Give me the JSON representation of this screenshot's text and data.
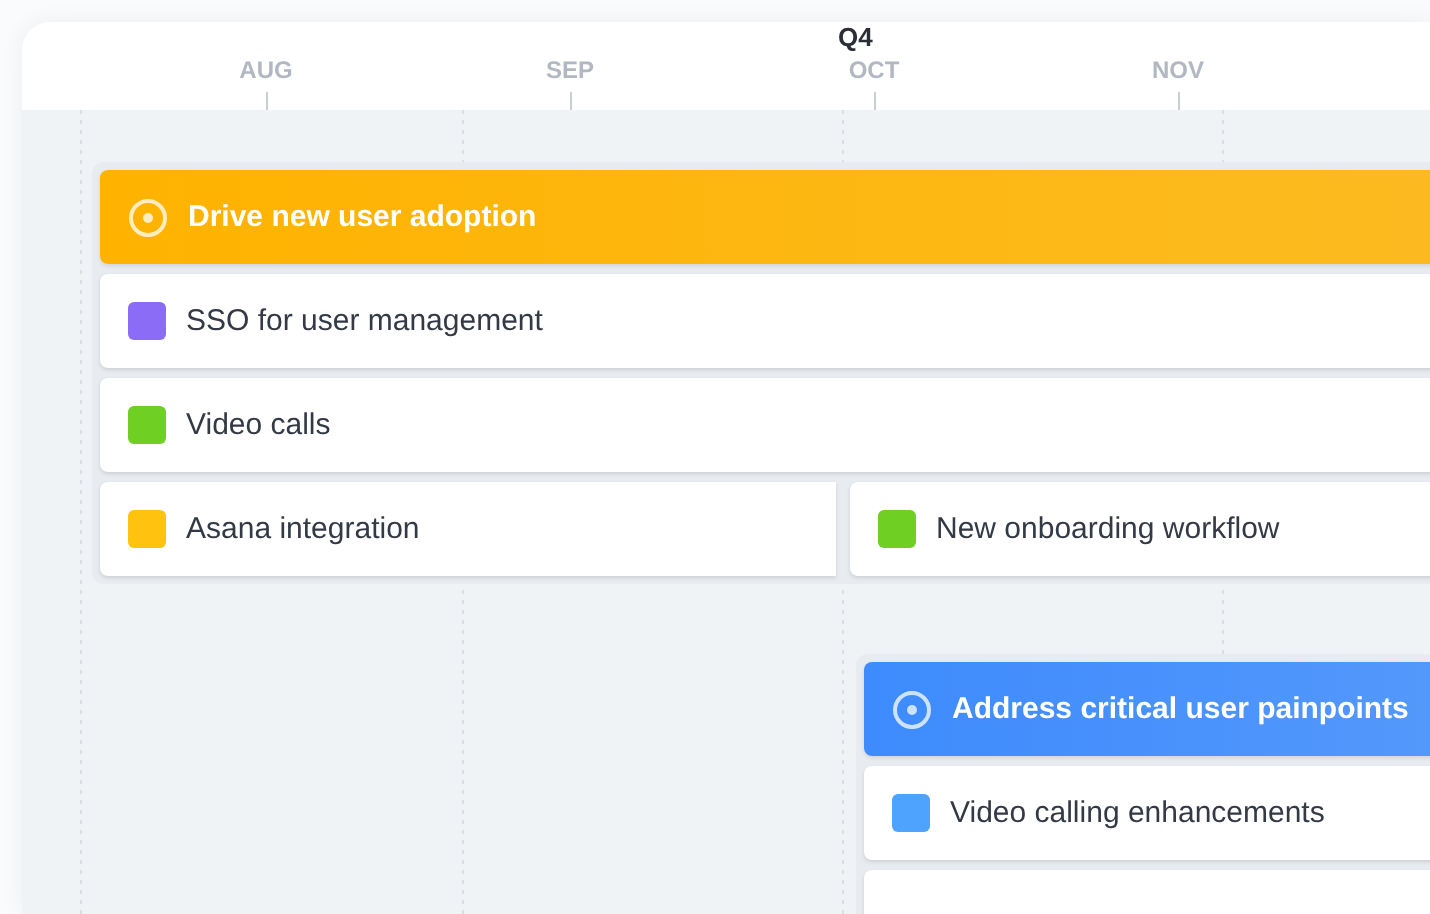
{
  "timeline": {
    "months": [
      {
        "label": "AUG"
      },
      {
        "label": "SEP"
      },
      {
        "label": "OCT",
        "quarter": "Q4"
      },
      {
        "label": "NOV"
      }
    ]
  },
  "goals": [
    {
      "title": "Drive new user adoption",
      "color": "#ffb300",
      "rows": [
        [
          {
            "kind": "task",
            "label": "SSO for user management",
            "color": "#8b6cf6"
          }
        ],
        [
          {
            "kind": "task",
            "label": "Video calls",
            "color": "#6fcf23"
          }
        ],
        [
          {
            "kind": "task",
            "label": "Asana integration",
            "color": "#ffc20e"
          },
          {
            "kind": "task",
            "label": "New onboarding workflow",
            "color": "#6fcf23"
          }
        ]
      ]
    },
    {
      "title": "Address critical user painpoints",
      "color": "#3d8bfd",
      "rows": [
        [
          {
            "kind": "task",
            "label": "Video calling enhancements",
            "color": "#4da3ff"
          }
        ],
        [
          {
            "kind": "blank"
          }
        ]
      ]
    }
  ]
}
